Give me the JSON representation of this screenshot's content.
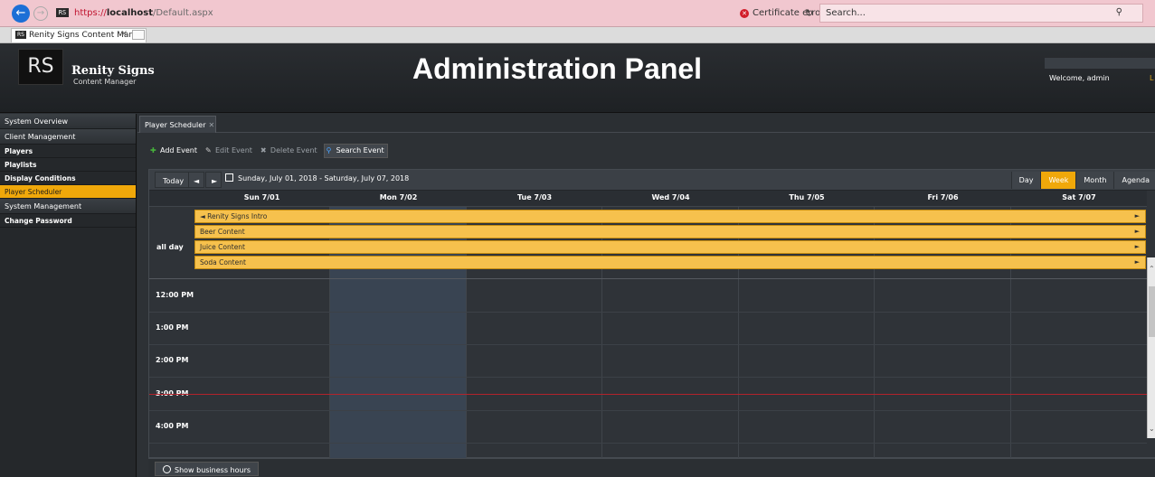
{
  "browser": {
    "url_prefix": "https://",
    "url_host": "localhost",
    "url_path": "/Default.aspx",
    "certificate": "Certificate error",
    "search_placeholder": "Search...",
    "tab_title": "Renity Signs Content Mana",
    "favicon_text": "RS"
  },
  "header": {
    "logo_text": "RS",
    "brand": "Renity Signs",
    "brand_sub": "Content Manager",
    "title": "Administration Panel",
    "welcome": "Welcome, admin",
    "logout": "L"
  },
  "sidebar": {
    "items": [
      {
        "label": "System Overview"
      },
      {
        "label": "Client Management"
      },
      {
        "label": "Players"
      },
      {
        "label": "Playlists"
      },
      {
        "label": "Display Conditions"
      },
      {
        "label": "Player Scheduler"
      },
      {
        "label": "System Management"
      },
      {
        "label": "Change Password"
      }
    ]
  },
  "main": {
    "tab_label": "Player Scheduler",
    "toolbar": {
      "add": "Add Event",
      "edit": "Edit Event",
      "delete": "Delete Event",
      "search": "Search Event"
    },
    "scheduler": {
      "today": "Today",
      "prev": "◄",
      "next": "►",
      "range": "Sunday, July 01, 2018 - Saturday, July 07, 2018",
      "views": [
        "Day",
        "Week",
        "Month",
        "Agenda"
      ],
      "active_view": "Week",
      "days": [
        "Sun 7/01",
        "Mon 7/02",
        "Tue 7/03",
        "Wed 7/04",
        "Thu 7/05",
        "Fri 7/06",
        "Sat 7/07"
      ],
      "today_day": "Mon 7/02",
      "all_day_label": "all day",
      "all_day_events": [
        {
          "title": "◄ Renity Signs Intro"
        },
        {
          "title": "Beer Content"
        },
        {
          "title": "Juice Content"
        },
        {
          "title": "Soda Content"
        }
      ],
      "event_arrow": "►",
      "times": [
        "12:00 PM",
        "1:00 PM",
        "2:00 PM",
        "3:00 PM",
        "4:00 PM"
      ],
      "event_color": "#f6c14d",
      "accent_color": "#f0a80a",
      "now_line_color": "#b3232b"
    },
    "footer": {
      "business_hours": "Show business hours"
    }
  }
}
